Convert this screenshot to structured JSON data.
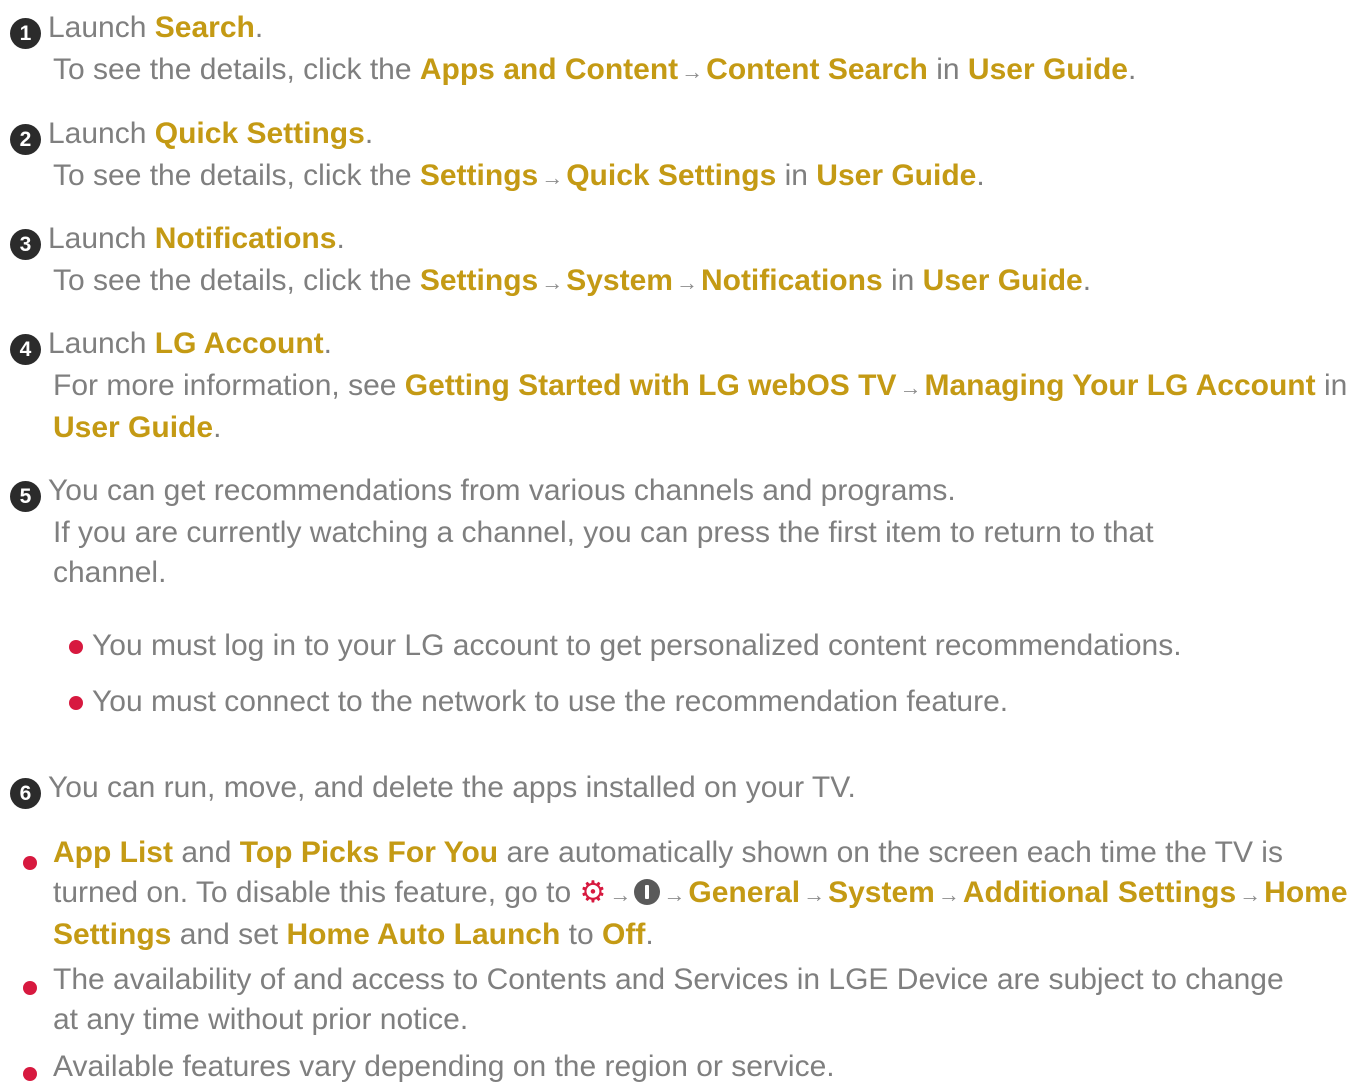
{
  "colors": {
    "text": "#7f7f7f",
    "highlight": "#c49a14",
    "bullet": "#d7193f",
    "badge": "#2b2b2b"
  },
  "items": [
    {
      "num": "1",
      "pre": "Launch ",
      "hl": "Search",
      "post": ".",
      "sub": {
        "pre": "To see the details, click the ",
        "a": "Apps and Content",
        "b": "Content Search",
        "mid": " in ",
        "guide": "User Guide",
        "end": "."
      }
    },
    {
      "num": "2",
      "pre": "Launch ",
      "hl": "Quick Settings",
      "post": ".",
      "sub": {
        "pre": "To see the details, click the ",
        "a": "Settings",
        "b": "Quick Settings",
        "mid": " in ",
        "guide": "User Guide",
        "end": "."
      }
    },
    {
      "num": "3",
      "pre": "Launch ",
      "hl": "Notifications",
      "post": ".",
      "sub": {
        "pre": "To see the details, click the ",
        "a": "Settings",
        "b": "System",
        "c": "Notifications",
        "mid": " in ",
        "guide": "User Guide",
        "end": "."
      }
    },
    {
      "num": "4",
      "pre": "Launch ",
      "hl": "LG Account",
      "post": ".",
      "sub": {
        "pre": "For more information, see ",
        "a": "Getting Started with LG webOS TV",
        "b": "Managing Your LG Account",
        "mid": " in ",
        "guide": "User Guide",
        "end": "."
      }
    },
    {
      "num": "5",
      "text": "You can get recommendations from various channels and programs.",
      "sub_text": "If you are currently watching a channel, you can press the first item to return to that channel.",
      "bullets": [
        "You must log in to your LG account to get personalized content recommendations.",
        "You must connect to the network to use the recommendation feature."
      ]
    },
    {
      "num": "6",
      "text": "You can run, move, and delete the apps installed on your TV."
    }
  ],
  "notes": {
    "n1": {
      "app_list": "App List",
      "and": " and ",
      "top_picks": "Top Picks For You",
      "t1": " are automatically shown on the screen each time the TV is turned on. To disable this feature, go to ",
      "settings_icon": "gear-icon",
      "more_icon": "more-icon",
      "general": "General",
      "system": "System",
      "additional": "Additional Settings",
      "home_settings": "Home Settings",
      "and_set": " and set ",
      "auto_launch": "Home Auto Launch",
      "to": " to ",
      "off": "Off",
      "end": "."
    },
    "n2": "The availability of and access to Contents and Services in LGE Device are subject to change at any time without prior notice.",
    "n3": "Available features vary depending on the region or service."
  },
  "arrow": "→"
}
